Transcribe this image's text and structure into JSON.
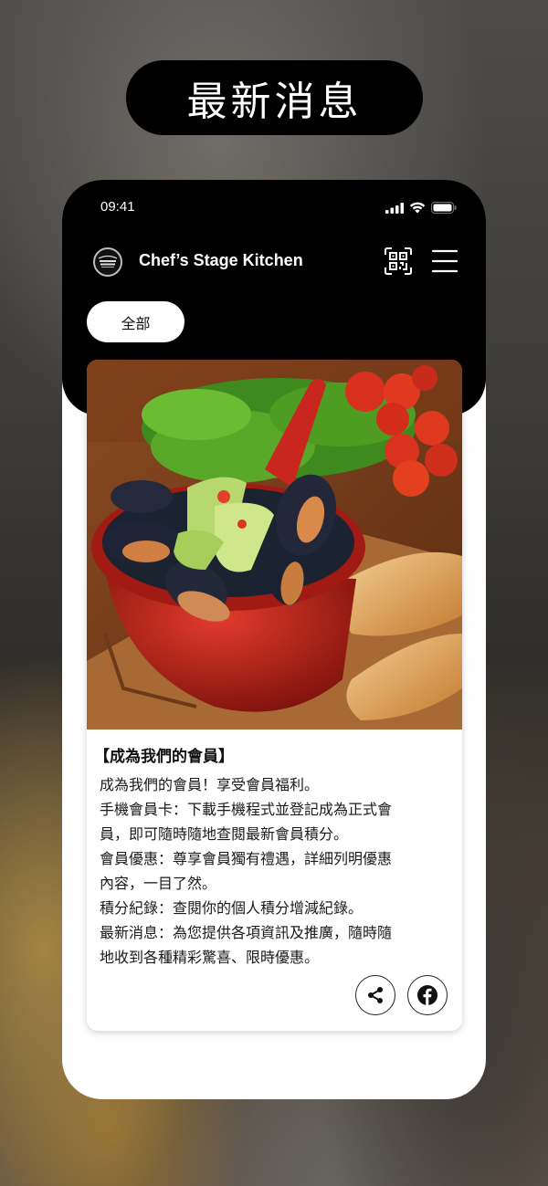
{
  "headline": "最新消息",
  "status_bar": {
    "time": "09:41",
    "icons": [
      "signal-icon",
      "wifi-icon",
      "battery-icon"
    ]
  },
  "app": {
    "title": "Chef’s Stage Kitchen",
    "icons": [
      "restaurant-logo-icon",
      "qr-code-icon",
      "hamburger-menu-icon"
    ]
  },
  "filter": {
    "selected": "全部"
  },
  "card": {
    "title": "【成為我們的會員】",
    "body": "成為我們的會員！享受會員福利。\n手機會員卡：下載手機程式並登記成為正式會\n員，即可隨時隨地查閱最新會員積分。\n會員優惠：尊享會員獨有禮遇，詳細列明優惠\n內容，一目了然。\n積分紀錄：查閱你的個人積分增減紀錄。\n最新消息：為您提供各項資訊及推廣，隨時隨\n地收到各種精彩驚喜、限時優惠。",
    "actions": [
      "share-icon",
      "facebook-icon"
    ]
  },
  "colors": {
    "brand": "#000000",
    "chip": "#ffffff",
    "pot": "#c8261e"
  }
}
